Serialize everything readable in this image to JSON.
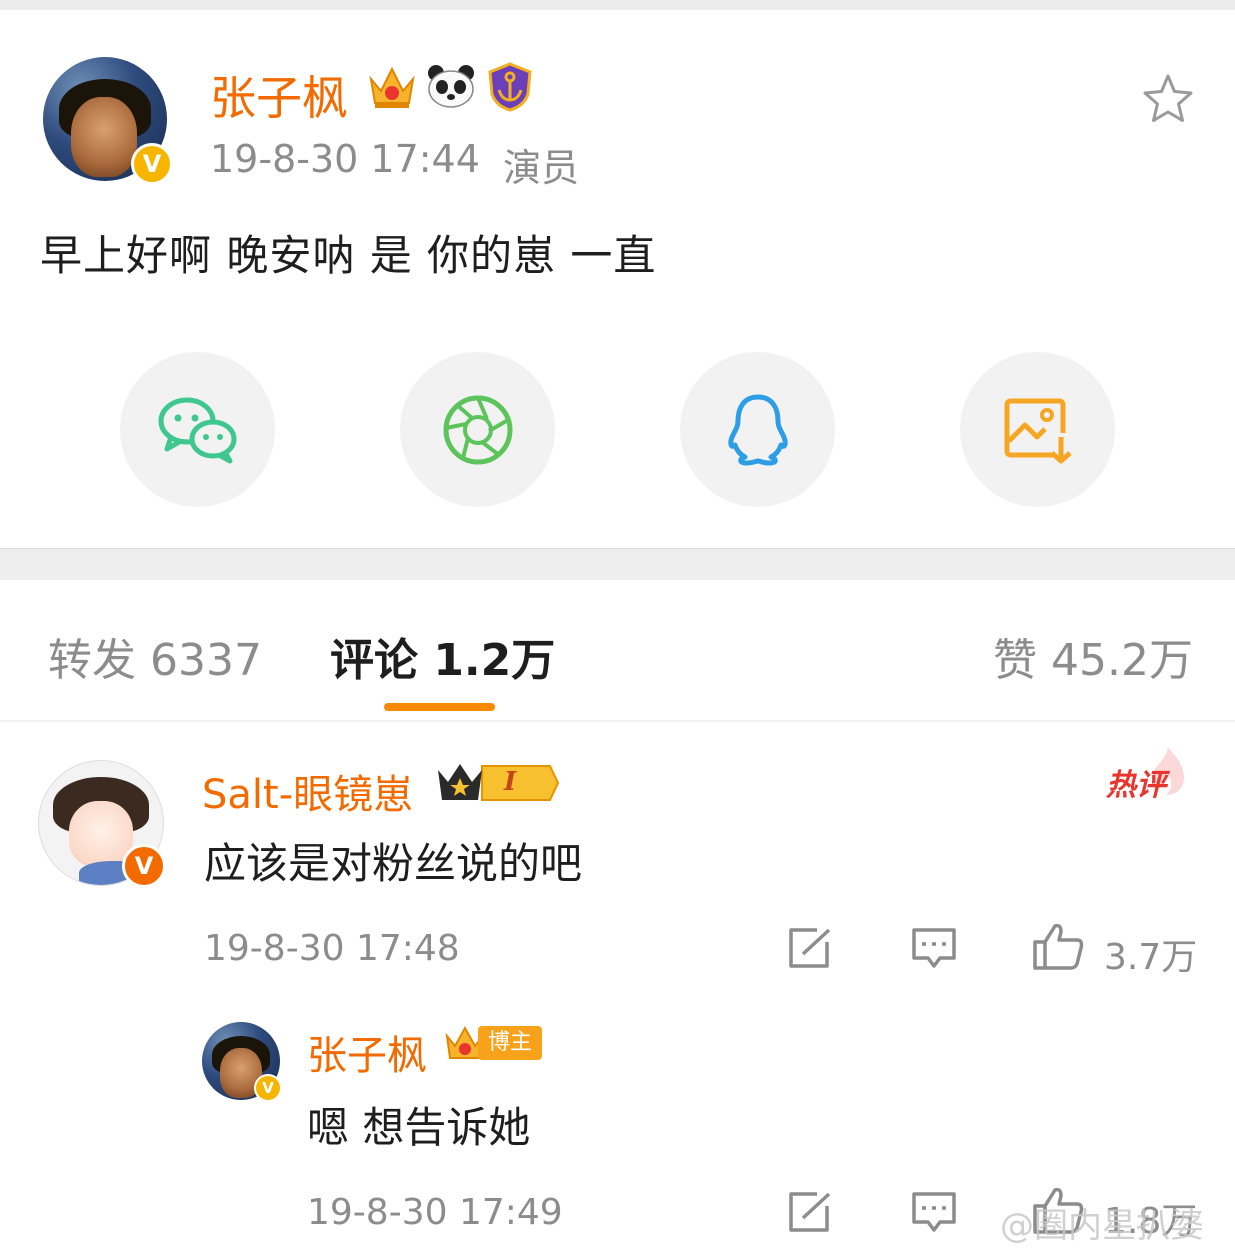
{
  "post": {
    "author": "张子枫",
    "time": "19-8-30 17:44",
    "source": "演员",
    "text": "早上好啊 晚安呐 是 你的崽 一直"
  },
  "share": {
    "items": [
      "wechat-icon",
      "moments-icon",
      "qq-icon",
      "save-image-icon"
    ]
  },
  "tabs": {
    "repost": "转发 6337",
    "comments": "评论 1.2万",
    "likes": "赞 45.2万"
  },
  "comments": [
    {
      "author": "Salt-眼镜崽",
      "level": "I",
      "hot_label": "热评",
      "text": "应该是对粉丝说的吧",
      "time": "19-8-30 17:48",
      "likes": "3.7万"
    }
  ],
  "reply": {
    "author": "张子枫",
    "badge": "博主",
    "text": "嗯 想告诉她",
    "time": "19-8-30 17:49",
    "likes": "1.8万"
  },
  "watermark": "@圈内星扒婆",
  "colors": {
    "accent_orange": "#f36b00",
    "tab_underline": "#f88a00",
    "hot": "#e8352e",
    "verified": "#f7b500",
    "wechat": "#3ec78f",
    "moments": "#5cc45a",
    "qq": "#2d9de5",
    "save": "#f5a623"
  }
}
